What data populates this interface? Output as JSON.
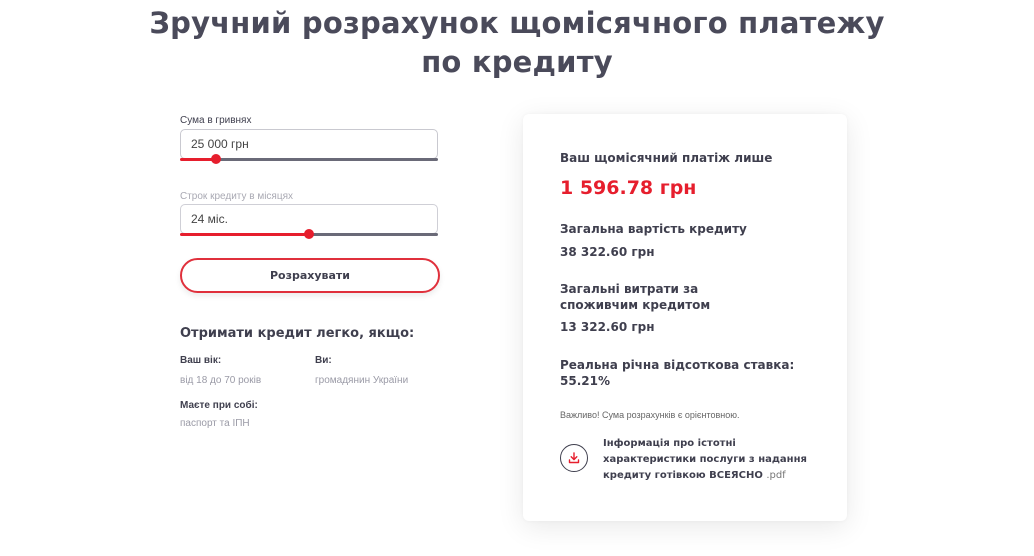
{
  "title": {
    "line1": "Зручний розрахунок щомісячного платежу",
    "line2": "по кредиту"
  },
  "calculator": {
    "amount": {
      "label": "Сума в гривнях",
      "value": "25 000 грн",
      "slider_fraction": 0.14
    },
    "term": {
      "label": "Строк кредиту в місяцях",
      "value": "24 міс.",
      "slider_fraction": 0.5
    },
    "calculate_label": "Розрахувати"
  },
  "conditions": {
    "title": "Отримати кредит легко, якщо:",
    "age_label": "Ваш вік:",
    "age_value": "від 18 до 70 років",
    "citizen_label": "Ви:",
    "citizen_value": "громадянин України",
    "docs_label": "Маєте при собі:",
    "docs_value": "паспорт та ІПН"
  },
  "result": {
    "monthly_label": "Ваш щомісячний платіж лише",
    "monthly_value": "1 596.78 грн",
    "total_label": "Загальна вартість кредиту",
    "total_value": "38 322.60 грн",
    "expenses_label": "Загальні витрати за споживчим кредитом",
    "expenses_value": "13 322.60 грн",
    "rate_label": "Реальна річна відсоткова ставка:",
    "rate_value": "55.21%",
    "note": "Важливо! Сума розрахунків є орієнтовною.",
    "download_text": "Інформація про істотні характеристики послуги з надання кредиту готівкою ВСЕЯСНО",
    "download_ext": ".pdf",
    "download_icon": "download-icon"
  },
  "colors": {
    "accent": "#e61e2d",
    "text": "#3f3f4e",
    "muted": "#9a9aa6"
  }
}
